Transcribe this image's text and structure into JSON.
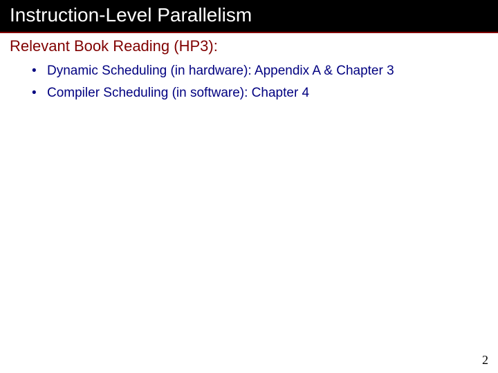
{
  "slide": {
    "title": "Instruction-Level Parallelism",
    "section_heading": "Relevant Book Reading (HP3):",
    "bullets": [
      "Dynamic Scheduling (in hardware):  Appendix A & Chapter 3",
      "Compiler Scheduling (in software):   Chapter 4"
    ],
    "page_number": "2"
  }
}
